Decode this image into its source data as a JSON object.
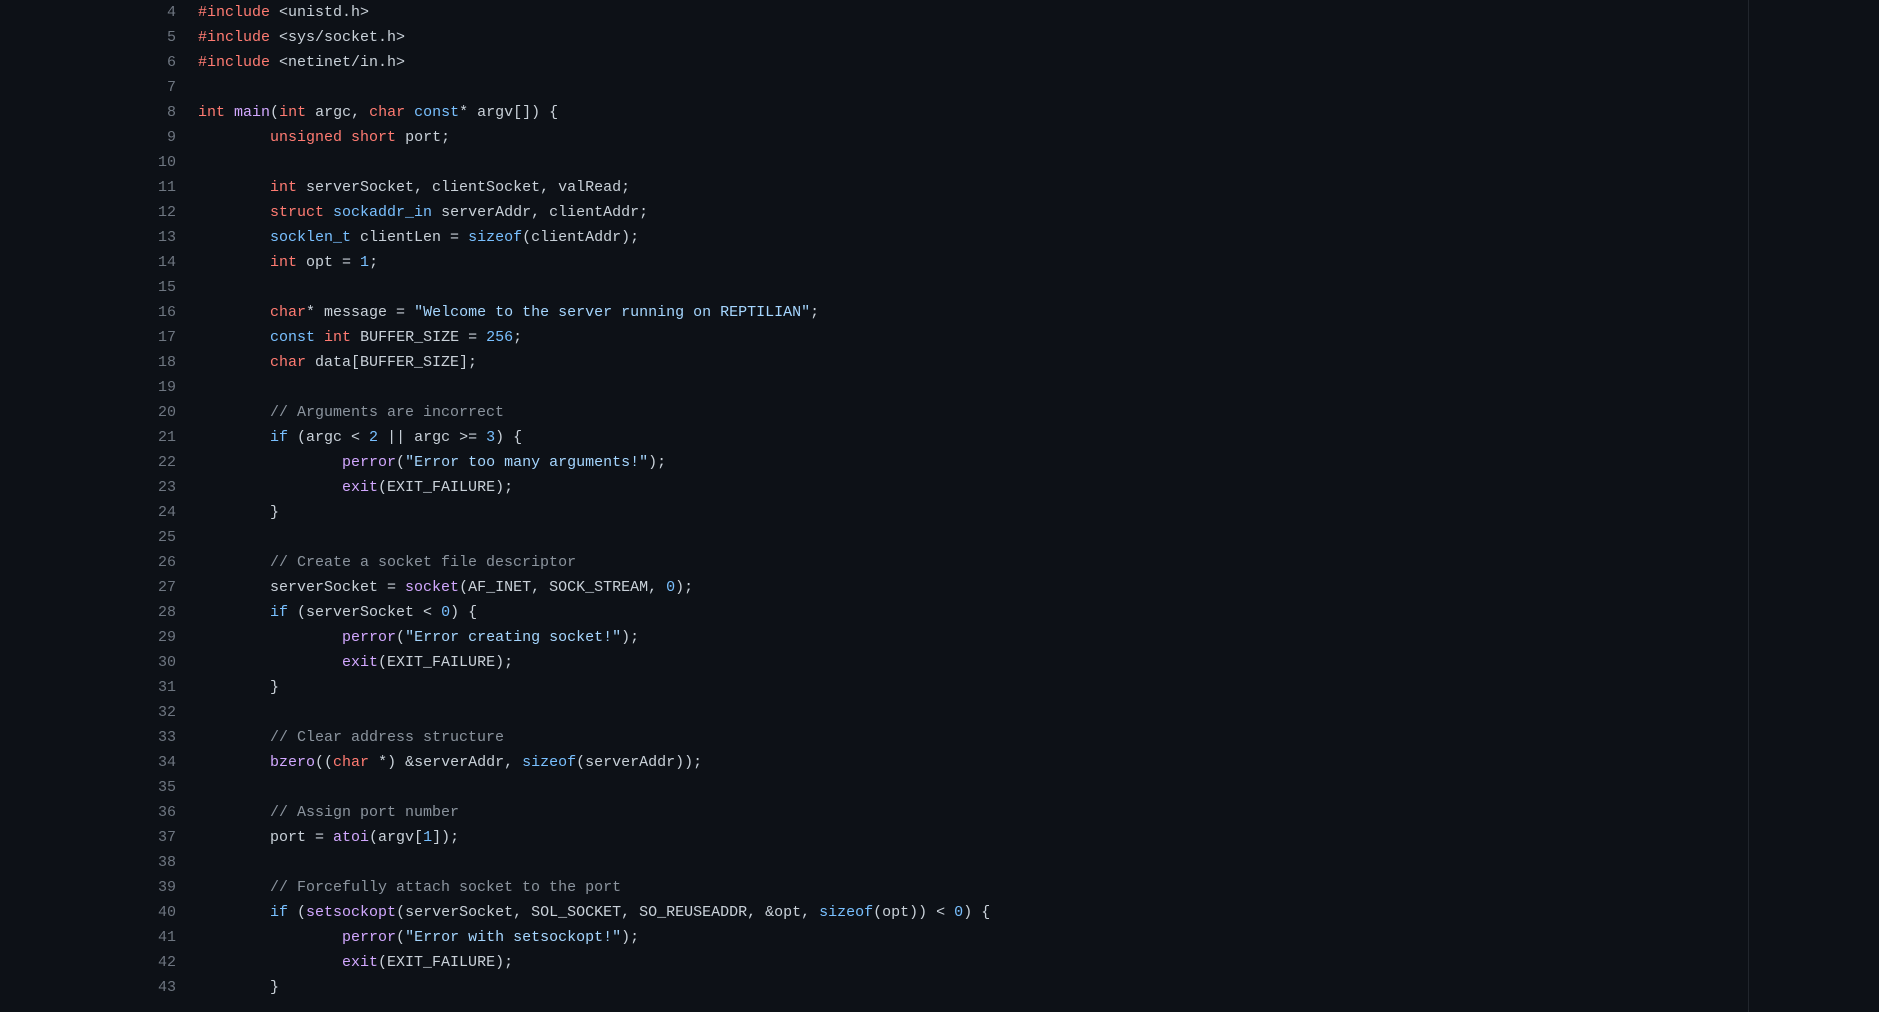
{
  "editor": {
    "first_line_number": 4,
    "lines": [
      [
        [
          "pp",
          "#include"
        ],
        [
          "punc",
          " "
        ],
        [
          "inc",
          "<unistd.h>"
        ]
      ],
      [
        [
          "pp",
          "#include"
        ],
        [
          "punc",
          " "
        ],
        [
          "inc",
          "<sys/socket.h>"
        ]
      ],
      [
        [
          "pp",
          "#include"
        ],
        [
          "punc",
          " "
        ],
        [
          "inc",
          "<netinet/in.h>"
        ]
      ],
      [],
      [
        [
          "kwb",
          "int"
        ],
        [
          "punc",
          " "
        ],
        [
          "fn",
          "main"
        ],
        [
          "punc",
          "("
        ],
        [
          "kwb",
          "int"
        ],
        [
          "punc",
          " argc, "
        ],
        [
          "kwb",
          "char"
        ],
        [
          "punc",
          " "
        ],
        [
          "kw2",
          "const"
        ],
        [
          "punc",
          "* argv[]) {"
        ]
      ],
      [
        [
          "punc",
          "        "
        ],
        [
          "kwb",
          "unsigned"
        ],
        [
          "punc",
          " "
        ],
        [
          "kwb",
          "short"
        ],
        [
          "punc",
          " port;"
        ]
      ],
      [],
      [
        [
          "punc",
          "        "
        ],
        [
          "kwb",
          "int"
        ],
        [
          "punc",
          " serverSocket, clientSocket, valRead;"
        ]
      ],
      [
        [
          "punc",
          "        "
        ],
        [
          "kwb",
          "struct"
        ],
        [
          "punc",
          " "
        ],
        [
          "const",
          "sockaddr_in"
        ],
        [
          "punc",
          " serverAddr, clientAddr;"
        ]
      ],
      [
        [
          "punc",
          "        "
        ],
        [
          "const",
          "socklen_t"
        ],
        [
          "punc",
          " clientLen = "
        ],
        [
          "kw2",
          "sizeof"
        ],
        [
          "punc",
          "(clientAddr);"
        ]
      ],
      [
        [
          "punc",
          "        "
        ],
        [
          "kwb",
          "int"
        ],
        [
          "punc",
          " opt = "
        ],
        [
          "num",
          "1"
        ],
        [
          "punc",
          ";"
        ]
      ],
      [],
      [
        [
          "punc",
          "        "
        ],
        [
          "kwb",
          "char"
        ],
        [
          "punc",
          "* message = "
        ],
        [
          "str",
          "\"Welcome to the server running on REPTILIAN\""
        ],
        [
          "punc",
          ";"
        ]
      ],
      [
        [
          "punc",
          "        "
        ],
        [
          "kw2",
          "const"
        ],
        [
          "punc",
          " "
        ],
        [
          "kwb",
          "int"
        ],
        [
          "punc",
          " BUFFER_SIZE = "
        ],
        [
          "num",
          "256"
        ],
        [
          "punc",
          ";"
        ]
      ],
      [
        [
          "punc",
          "        "
        ],
        [
          "kwb",
          "char"
        ],
        [
          "punc",
          " data[BUFFER_SIZE];"
        ]
      ],
      [],
      [
        [
          "punc",
          "        "
        ],
        [
          "cmt",
          "// Arguments are incorrect"
        ]
      ],
      [
        [
          "punc",
          "        "
        ],
        [
          "kw2",
          "if"
        ],
        [
          "punc",
          " (argc < "
        ],
        [
          "num",
          "2"
        ],
        [
          "punc",
          " || argc >= "
        ],
        [
          "num",
          "3"
        ],
        [
          "punc",
          ") {"
        ]
      ],
      [
        [
          "punc",
          "                "
        ],
        [
          "fn",
          "perror"
        ],
        [
          "punc",
          "("
        ],
        [
          "str",
          "\"Error too many arguments!\""
        ],
        [
          "punc",
          ");"
        ]
      ],
      [
        [
          "punc",
          "                "
        ],
        [
          "fn",
          "exit"
        ],
        [
          "punc",
          "(EXIT_FAILURE);"
        ]
      ],
      [
        [
          "punc",
          "        }"
        ]
      ],
      [],
      [
        [
          "punc",
          "        "
        ],
        [
          "cmt",
          "// Create a socket file descriptor"
        ]
      ],
      [
        [
          "punc",
          "        serverSocket = "
        ],
        [
          "fn",
          "socket"
        ],
        [
          "punc",
          "(AF_INET, SOCK_STREAM, "
        ],
        [
          "num",
          "0"
        ],
        [
          "punc",
          ");"
        ]
      ],
      [
        [
          "punc",
          "        "
        ],
        [
          "kw2",
          "if"
        ],
        [
          "punc",
          " (serverSocket < "
        ],
        [
          "num",
          "0"
        ],
        [
          "punc",
          ") {"
        ]
      ],
      [
        [
          "punc",
          "                "
        ],
        [
          "fn",
          "perror"
        ],
        [
          "punc",
          "("
        ],
        [
          "str",
          "\"Error creating socket!\""
        ],
        [
          "punc",
          ");"
        ]
      ],
      [
        [
          "punc",
          "                "
        ],
        [
          "fn",
          "exit"
        ],
        [
          "punc",
          "(EXIT_FAILURE);"
        ]
      ],
      [
        [
          "punc",
          "        }"
        ]
      ],
      [],
      [
        [
          "punc",
          "        "
        ],
        [
          "cmt",
          "// Clear address structure"
        ]
      ],
      [
        [
          "punc",
          "        "
        ],
        [
          "fn",
          "bzero"
        ],
        [
          "punc",
          "(("
        ],
        [
          "kwb",
          "char"
        ],
        [
          "punc",
          " *) &serverAddr, "
        ],
        [
          "kw2",
          "sizeof"
        ],
        [
          "punc",
          "(serverAddr));"
        ]
      ],
      [],
      [
        [
          "punc",
          "        "
        ],
        [
          "cmt",
          "// Assign port number"
        ]
      ],
      [
        [
          "punc",
          "        port = "
        ],
        [
          "fn",
          "atoi"
        ],
        [
          "punc",
          "(argv["
        ],
        [
          "num",
          "1"
        ],
        [
          "punc",
          "]);"
        ]
      ],
      [],
      [
        [
          "punc",
          "        "
        ],
        [
          "cmt",
          "// Forcefully attach socket to the port"
        ]
      ],
      [
        [
          "punc",
          "        "
        ],
        [
          "kw2",
          "if"
        ],
        [
          "punc",
          " ("
        ],
        [
          "fn",
          "setsockopt"
        ],
        [
          "punc",
          "(serverSocket, SOL_SOCKET, SO_REUSEADDR, &opt, "
        ],
        [
          "kw2",
          "sizeof"
        ],
        [
          "punc",
          "(opt)) < "
        ],
        [
          "num",
          "0"
        ],
        [
          "punc",
          ") {"
        ]
      ],
      [
        [
          "punc",
          "                "
        ],
        [
          "fn",
          "perror"
        ],
        [
          "punc",
          "("
        ],
        [
          "str",
          "\"Error with setsockopt!\""
        ],
        [
          "punc",
          ");"
        ]
      ],
      [
        [
          "punc",
          "                "
        ],
        [
          "fn",
          "exit"
        ],
        [
          "punc",
          "(EXIT_FAILURE);"
        ]
      ],
      [
        [
          "punc",
          "        }"
        ]
      ]
    ]
  }
}
